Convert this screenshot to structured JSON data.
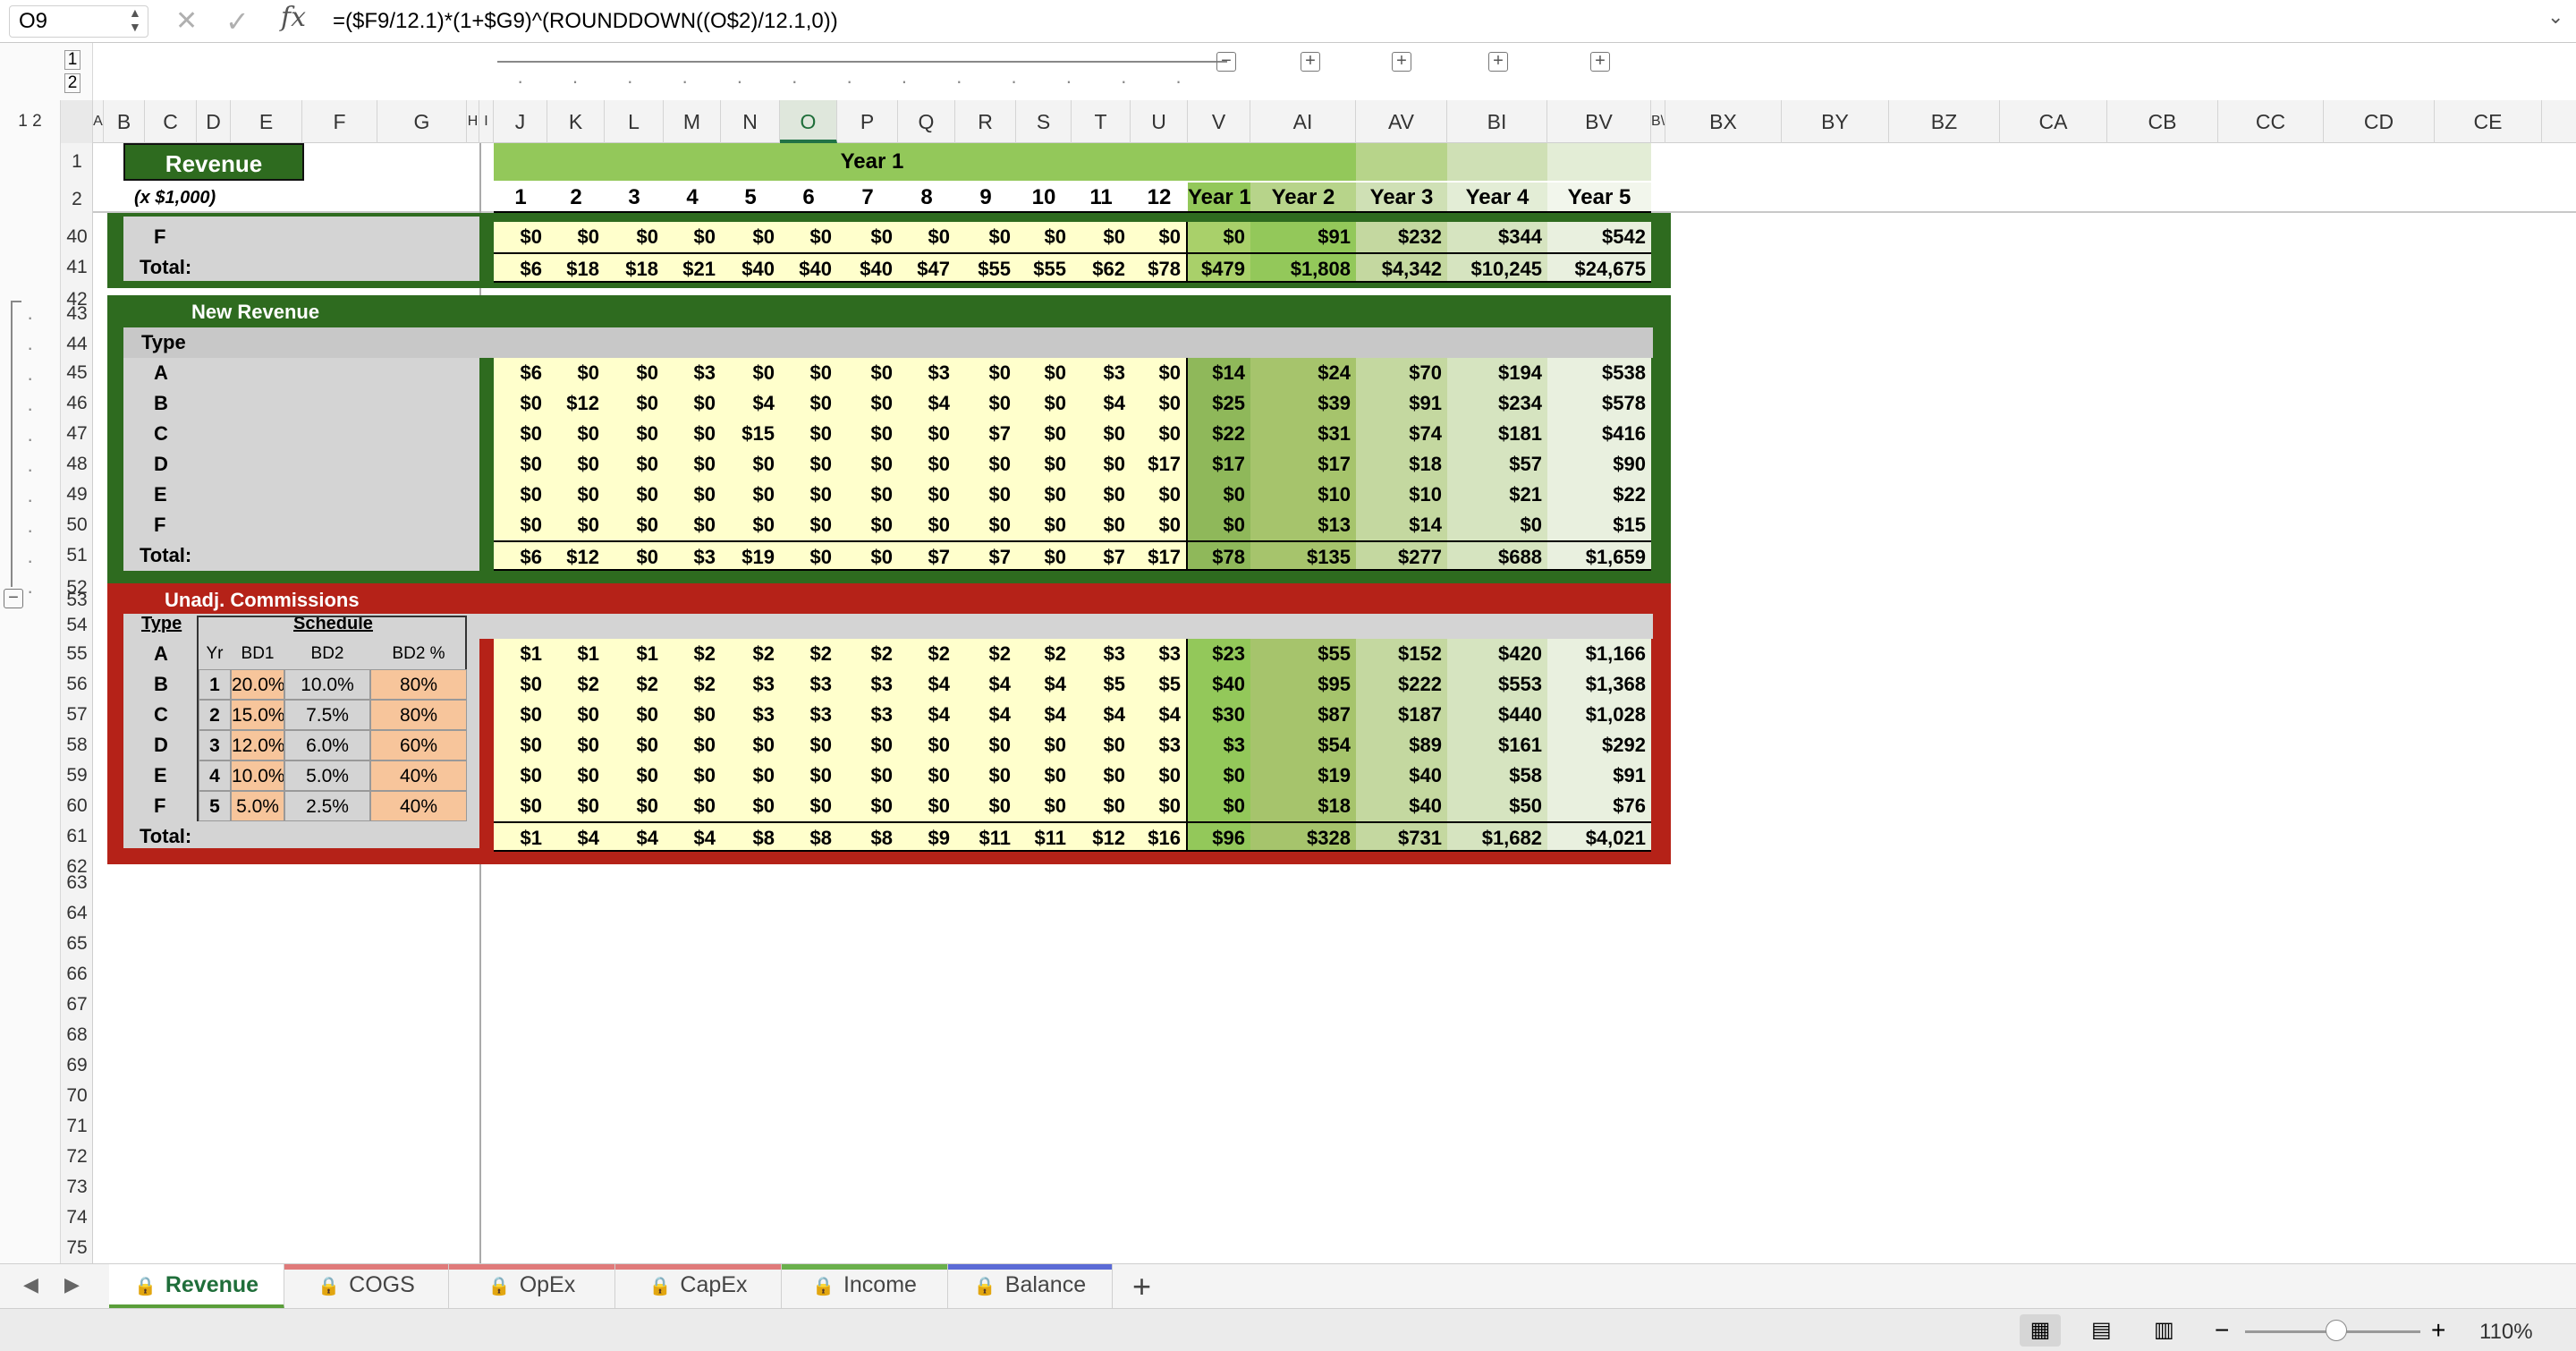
{
  "formula_bar": {
    "cell_ref": "O9",
    "cancel_icon": "✕",
    "enter_icon": "✓",
    "fx": "fx",
    "formula": "=($F9/12.1)*(1+$G9)^(ROUNDDOWN((O$2)/12.1,0))"
  },
  "outline": {
    "levels_rows": [
      "1",
      "2"
    ],
    "levels_cols": [
      "1",
      "2"
    ]
  },
  "columns": [
    "A",
    "B",
    "C",
    "D",
    "E",
    "F",
    "G",
    "H",
    "I",
    "J",
    "K",
    "L",
    "M",
    "N",
    "O",
    "P",
    "Q",
    "R",
    "S",
    "T",
    "U",
    "V",
    "AI",
    "AV",
    "BI",
    "BV",
    "B\\",
    "BX",
    "BY",
    "BZ",
    "CA",
    "CB",
    "CC",
    "CD",
    "CE"
  ],
  "selected_column": "O",
  "header": {
    "title": "Revenue",
    "units": "(x $1,000)",
    "year1_label": "Year 1",
    "months": [
      "1",
      "2",
      "3",
      "4",
      "5",
      "6",
      "7",
      "8",
      "9",
      "10",
      "11",
      "12"
    ],
    "years": [
      "Year 1",
      "Year 2",
      "Year 3",
      "Year 4",
      "Year 5"
    ]
  },
  "row_numbers_top": [
    "1",
    "2"
  ],
  "section1": {
    "rows": [
      {
        "num": "40",
        "label": "F",
        "values": [
          "$0",
          "$0",
          "$0",
          "$0",
          "$0",
          "$0",
          "$0",
          "$0",
          "$0",
          "$0",
          "$0",
          "$0",
          "$0",
          "$91",
          "$232",
          "$344",
          "$542"
        ]
      },
      {
        "num": "41",
        "label": "Total:",
        "values": [
          "$6",
          "$18",
          "$18",
          "$21",
          "$40",
          "$40",
          "$40",
          "$47",
          "$55",
          "$55",
          "$62",
          "$78",
          "$479",
          "$1,808",
          "$4,342",
          "$10,245",
          "$24,675"
        ]
      }
    ]
  },
  "section2": {
    "title": "New Revenue",
    "row_title": "43",
    "row_gap": "42",
    "type_label": "Type",
    "row_type": "44",
    "rows": [
      {
        "num": "45",
        "label": "A",
        "values": [
          "$6",
          "$0",
          "$0",
          "$3",
          "$0",
          "$0",
          "$0",
          "$3",
          "$0",
          "$0",
          "$3",
          "$0",
          "$14",
          "$24",
          "$70",
          "$194",
          "$538"
        ]
      },
      {
        "num": "46",
        "label": "B",
        "values": [
          "$0",
          "$12",
          "$0",
          "$0",
          "$4",
          "$0",
          "$0",
          "$4",
          "$0",
          "$0",
          "$4",
          "$0",
          "$25",
          "$39",
          "$91",
          "$234",
          "$578"
        ]
      },
      {
        "num": "47",
        "label": "C",
        "values": [
          "$0",
          "$0",
          "$0",
          "$0",
          "$15",
          "$0",
          "$0",
          "$0",
          "$7",
          "$0",
          "$0",
          "$0",
          "$22",
          "$31",
          "$74",
          "$181",
          "$416"
        ]
      },
      {
        "num": "48",
        "label": "D",
        "values": [
          "$0",
          "$0",
          "$0",
          "$0",
          "$0",
          "$0",
          "$0",
          "$0",
          "$0",
          "$0",
          "$0",
          "$17",
          "$17",
          "$17",
          "$18",
          "$57",
          "$90"
        ]
      },
      {
        "num": "49",
        "label": "E",
        "values": [
          "$0",
          "$0",
          "$0",
          "$0",
          "$0",
          "$0",
          "$0",
          "$0",
          "$0",
          "$0",
          "$0",
          "$0",
          "$0",
          "$10",
          "$10",
          "$21",
          "$22"
        ]
      },
      {
        "num": "50",
        "label": "F",
        "values": [
          "$0",
          "$0",
          "$0",
          "$0",
          "$0",
          "$0",
          "$0",
          "$0",
          "$0",
          "$0",
          "$0",
          "$0",
          "$0",
          "$13",
          "$14",
          "$0",
          "$15"
        ]
      },
      {
        "num": "51",
        "label": "Total:",
        "values": [
          "$6",
          "$12",
          "$0",
          "$3",
          "$19",
          "$0",
          "$0",
          "$7",
          "$7",
          "$0",
          "$7",
          "$17",
          "$78",
          "$135",
          "$277",
          "$688",
          "$1,659"
        ]
      }
    ]
  },
  "section3": {
    "title": "Unadj. Commissions",
    "row_title": "53",
    "row_gap": "52",
    "type_label": "Type",
    "schedule_label": "Schedule",
    "row_type": "54",
    "sched_headers": [
      "Yr",
      "BD1",
      "BD2",
      "BD2 %"
    ],
    "rows": [
      {
        "num": "55",
        "label": "A",
        "sched": [
          "",
          "",
          "",
          ""
        ],
        "values": [
          "$1",
          "$1",
          "$1",
          "$2",
          "$2",
          "$2",
          "$2",
          "$2",
          "$2",
          "$2",
          "$3",
          "$3",
          "$23",
          "$55",
          "$152",
          "$420",
          "$1,166"
        ]
      },
      {
        "num": "56",
        "label": "B",
        "sched": [
          "1",
          "20.0%",
          "10.0%",
          "80%"
        ],
        "values": [
          "$0",
          "$2",
          "$2",
          "$2",
          "$3",
          "$3",
          "$3",
          "$4",
          "$4",
          "$4",
          "$5",
          "$5",
          "$40",
          "$95",
          "$222",
          "$553",
          "$1,368"
        ]
      },
      {
        "num": "57",
        "label": "C",
        "sched": [
          "2",
          "15.0%",
          "7.5%",
          "80%"
        ],
        "values": [
          "$0",
          "$0",
          "$0",
          "$0",
          "$3",
          "$3",
          "$3",
          "$4",
          "$4",
          "$4",
          "$4",
          "$4",
          "$30",
          "$87",
          "$187",
          "$440",
          "$1,028"
        ]
      },
      {
        "num": "58",
        "label": "D",
        "sched": [
          "3",
          "12.0%",
          "6.0%",
          "60%"
        ],
        "values": [
          "$0",
          "$0",
          "$0",
          "$0",
          "$0",
          "$0",
          "$0",
          "$0",
          "$0",
          "$0",
          "$0",
          "$3",
          "$3",
          "$54",
          "$89",
          "$161",
          "$292"
        ]
      },
      {
        "num": "59",
        "label": "E",
        "sched": [
          "4",
          "10.0%",
          "5.0%",
          "40%"
        ],
        "values": [
          "$0",
          "$0",
          "$0",
          "$0",
          "$0",
          "$0",
          "$0",
          "$0",
          "$0",
          "$0",
          "$0",
          "$0",
          "$0",
          "$19",
          "$40",
          "$58",
          "$91"
        ]
      },
      {
        "num": "60",
        "label": "F",
        "sched": [
          "5",
          "5.0%",
          "2.5%",
          "40%"
        ],
        "values": [
          "$0",
          "$0",
          "$0",
          "$0",
          "$0",
          "$0",
          "$0",
          "$0",
          "$0",
          "$0",
          "$0",
          "$0",
          "$0",
          "$18",
          "$40",
          "$50",
          "$76"
        ]
      },
      {
        "num": "61",
        "label": "Total:",
        "sched": [
          "",
          "",
          "",
          ""
        ],
        "values": [
          "$1",
          "$4",
          "$4",
          "$4",
          "$8",
          "$8",
          "$8",
          "$9",
          "$11",
          "$11",
          "$12",
          "$16",
          "$96",
          "$328",
          "$731",
          "$1,682",
          "$4,021"
        ]
      }
    ],
    "row_after": "62"
  },
  "empty_rows": [
    "63",
    "64",
    "65",
    "66",
    "67",
    "68",
    "69",
    "70",
    "71",
    "72",
    "73",
    "74",
    "75"
  ],
  "sheet_tabs": [
    {
      "name": "Revenue",
      "active": true,
      "color": "#5a9e3a"
    },
    {
      "name": "COGS",
      "active": false,
      "color": "#e07a7a"
    },
    {
      "name": "OpEx",
      "active": false,
      "color": "#e07a7a"
    },
    {
      "name": "CapEx",
      "active": false,
      "color": "#e07a7a"
    },
    {
      "name": "Income",
      "active": false,
      "color": "#6ab04c"
    },
    {
      "name": "Balance",
      "active": false,
      "color": "#5b6bd6"
    }
  ],
  "add_sheet": "+",
  "status": {
    "zoom": "110%",
    "zoom_minus": "−",
    "zoom_plus": "+"
  },
  "colors": {
    "green_dark": "#2e6b1f",
    "red_dark": "#b52218",
    "cream": "#ffffcc",
    "year_header_green": "#93c85a",
    "salmon": "#f7c59b"
  }
}
